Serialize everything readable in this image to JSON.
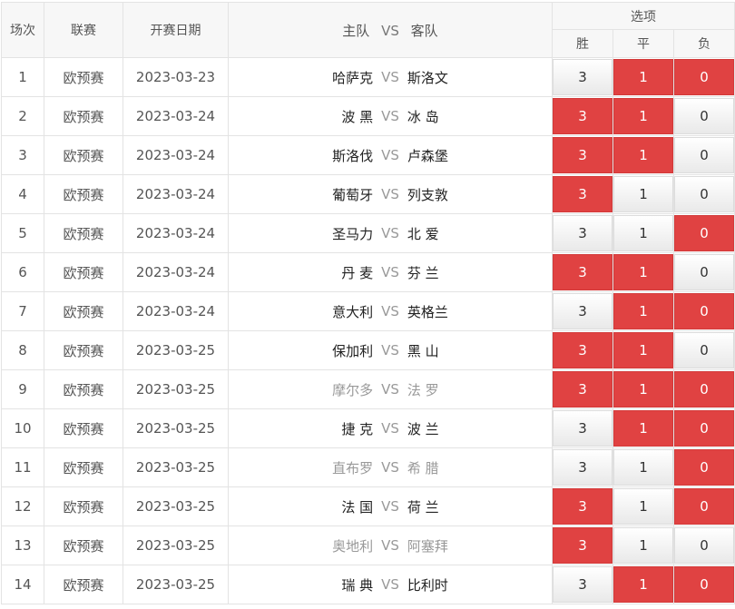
{
  "header": {
    "col_index": "场次",
    "col_league": "联赛",
    "col_date": "开赛日期",
    "col_home": "主队",
    "col_vs": "VS",
    "col_away": "客队",
    "col_options": "选项",
    "opt_win": "胜",
    "opt_draw": "平",
    "opt_lose": "负"
  },
  "colors": {
    "selected": "#e04242",
    "muted_team": "#999999"
  },
  "matches": [
    {
      "no": "1",
      "league": "欧预赛",
      "date": "2023-03-23",
      "home": "哈萨克",
      "vs": "VS",
      "away": "斯洛文",
      "muted": false,
      "win": "3",
      "draw": "1",
      "lose": "0",
      "sel_win": false,
      "sel_draw": true,
      "sel_lose": true
    },
    {
      "no": "2",
      "league": "欧预赛",
      "date": "2023-03-24",
      "home": "波 黑",
      "vs": "VS",
      "away": "冰 岛",
      "muted": false,
      "win": "3",
      "draw": "1",
      "lose": "0",
      "sel_win": true,
      "sel_draw": true,
      "sel_lose": false
    },
    {
      "no": "3",
      "league": "欧预赛",
      "date": "2023-03-24",
      "home": "斯洛伐",
      "vs": "VS",
      "away": "卢森堡",
      "muted": false,
      "win": "3",
      "draw": "1",
      "lose": "0",
      "sel_win": true,
      "sel_draw": true,
      "sel_lose": false
    },
    {
      "no": "4",
      "league": "欧预赛",
      "date": "2023-03-24",
      "home": "葡萄牙",
      "vs": "VS",
      "away": "列支敦",
      "muted": false,
      "win": "3",
      "draw": "1",
      "lose": "0",
      "sel_win": true,
      "sel_draw": false,
      "sel_lose": false
    },
    {
      "no": "5",
      "league": "欧预赛",
      "date": "2023-03-24",
      "home": "圣马力",
      "vs": "VS",
      "away": "北 爱",
      "muted": false,
      "win": "3",
      "draw": "1",
      "lose": "0",
      "sel_win": false,
      "sel_draw": false,
      "sel_lose": true
    },
    {
      "no": "6",
      "league": "欧预赛",
      "date": "2023-03-24",
      "home": "丹 麦",
      "vs": "VS",
      "away": "芬 兰",
      "muted": false,
      "win": "3",
      "draw": "1",
      "lose": "0",
      "sel_win": true,
      "sel_draw": true,
      "sel_lose": false
    },
    {
      "no": "7",
      "league": "欧预赛",
      "date": "2023-03-24",
      "home": "意大利",
      "vs": "VS",
      "away": "英格兰",
      "muted": false,
      "win": "3",
      "draw": "1",
      "lose": "0",
      "sel_win": false,
      "sel_draw": true,
      "sel_lose": true
    },
    {
      "no": "8",
      "league": "欧预赛",
      "date": "2023-03-25",
      "home": "保加利",
      "vs": "VS",
      "away": "黑 山",
      "muted": false,
      "win": "3",
      "draw": "1",
      "lose": "0",
      "sel_win": true,
      "sel_draw": true,
      "sel_lose": false
    },
    {
      "no": "9",
      "league": "欧预赛",
      "date": "2023-03-25",
      "home": "摩尔多",
      "vs": "VS",
      "away": "法 罗",
      "muted": true,
      "win": "3",
      "draw": "1",
      "lose": "0",
      "sel_win": true,
      "sel_draw": true,
      "sel_lose": true
    },
    {
      "no": "10",
      "league": "欧预赛",
      "date": "2023-03-25",
      "home": "捷 克",
      "vs": "VS",
      "away": "波 兰",
      "muted": false,
      "win": "3",
      "draw": "1",
      "lose": "0",
      "sel_win": false,
      "sel_draw": true,
      "sel_lose": true
    },
    {
      "no": "11",
      "league": "欧预赛",
      "date": "2023-03-25",
      "home": "直布罗",
      "vs": "VS",
      "away": "希 腊",
      "muted": true,
      "win": "3",
      "draw": "1",
      "lose": "0",
      "sel_win": false,
      "sel_draw": false,
      "sel_lose": true
    },
    {
      "no": "12",
      "league": "欧预赛",
      "date": "2023-03-25",
      "home": "法 国",
      "vs": "VS",
      "away": "荷 兰",
      "muted": false,
      "win": "3",
      "draw": "1",
      "lose": "0",
      "sel_win": true,
      "sel_draw": false,
      "sel_lose": true
    },
    {
      "no": "13",
      "league": "欧预赛",
      "date": "2023-03-25",
      "home": "奥地利",
      "vs": "VS",
      "away": "阿塞拜",
      "muted": true,
      "win": "3",
      "draw": "1",
      "lose": "0",
      "sel_win": true,
      "sel_draw": false,
      "sel_lose": false
    },
    {
      "no": "14",
      "league": "欧预赛",
      "date": "2023-03-25",
      "home": "瑞 典",
      "vs": "VS",
      "away": "比利时",
      "muted": false,
      "win": "3",
      "draw": "1",
      "lose": "0",
      "sel_win": false,
      "sel_draw": true,
      "sel_lose": true
    }
  ]
}
